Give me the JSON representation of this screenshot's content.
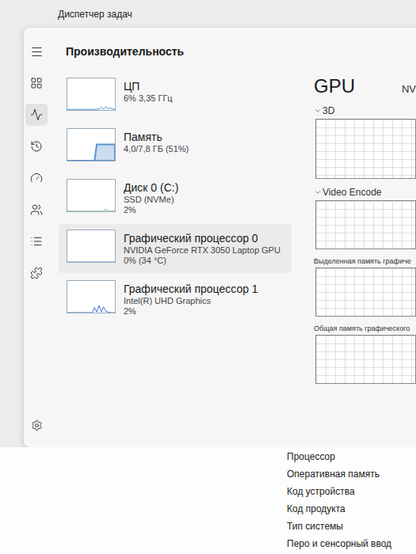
{
  "window": {
    "title": "Диспетчер задач"
  },
  "page": {
    "title": "Производительность"
  },
  "sidebar": {
    "items": [
      {
        "selected": false
      },
      {
        "selected": true
      },
      {
        "selected": false
      },
      {
        "selected": false
      },
      {
        "selected": false
      },
      {
        "selected": false
      },
      {
        "selected": false
      }
    ]
  },
  "devices": [
    {
      "name": "ЦП",
      "sub": "",
      "reading": "6% 3,35 ГГц",
      "selected": false,
      "kind": "line",
      "color": "#4a8fd6",
      "values": [
        2,
        2,
        2,
        2,
        2,
        2,
        2,
        2,
        2,
        2,
        2,
        2,
        2,
        3,
        2,
        9,
        3,
        11,
        4,
        7,
        3,
        2
      ]
    },
    {
      "name": "Память",
      "sub": "",
      "reading": "4,0/7,8 ГБ (51%)",
      "selected": false,
      "kind": "area",
      "color": "#5b93cf",
      "values": [
        0,
        0,
        0,
        0,
        0,
        0,
        0,
        0,
        0,
        0,
        0,
        0,
        0,
        51,
        51,
        51,
        51,
        51,
        51,
        51,
        51,
        51
      ]
    },
    {
      "name": "Диск 0 (C:)",
      "sub": "SSD (NVMe)",
      "reading": "2%",
      "selected": false,
      "kind": "line",
      "color": "#5aa05a",
      "values": [
        0,
        0,
        0,
        0,
        0,
        0,
        0,
        0,
        0,
        0,
        0,
        0,
        0,
        0,
        0,
        0,
        0,
        6,
        0,
        0,
        0,
        0
      ]
    },
    {
      "name": "Графический процессор 0",
      "sub": "NVIDIA GeForce RTX 3050 Laptop GPU",
      "reading": "0% (34 °C)",
      "selected": true,
      "kind": "line",
      "color": "#4a8fd6",
      "values": [
        0,
        0,
        0,
        0,
        0,
        0,
        0,
        0,
        0,
        0,
        0,
        0,
        0,
        0,
        0,
        0,
        0,
        0,
        0,
        0,
        0,
        0
      ]
    },
    {
      "name": "Графический процессор 1",
      "sub": "Intel(R) UHD Graphics",
      "reading": "2%",
      "selected": false,
      "kind": "line",
      "color": "#4a6fd6",
      "values": [
        0,
        0,
        0,
        0,
        0,
        0,
        0,
        0,
        0,
        0,
        0,
        0,
        16,
        2,
        22,
        3,
        18,
        4,
        2,
        0,
        0,
        0
      ]
    }
  ],
  "detail": {
    "title": "GPU",
    "vendor": "NV",
    "charts": [
      {
        "label": "3D",
        "expanded": true,
        "values": []
      },
      {
        "label": "Video Encode",
        "expanded": true,
        "values": []
      },
      {
        "label": "Выделенная память графиче",
        "expanded": false,
        "values": []
      },
      {
        "label": "Общая память графического",
        "expanded": false,
        "values": []
      }
    ]
  },
  "background": {
    "lines": [
      "Процессор",
      "Оперативная память",
      "Код устройства",
      "Код продукта",
      "Тип системы",
      "Перо и сенсорный ввод"
    ]
  }
}
